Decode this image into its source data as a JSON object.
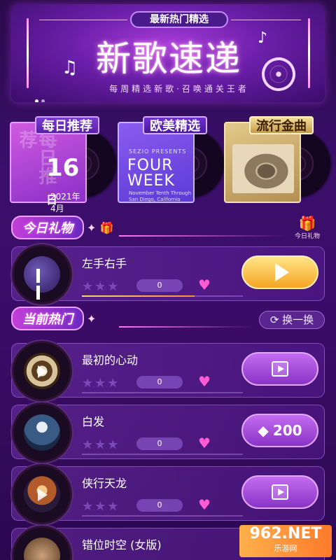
{
  "banner": {
    "pill": "最新热门精选",
    "title": "新歌速递",
    "subtitle": "每周精选新歌·召唤通关王者"
  },
  "categories": [
    {
      "label": "每日推荐",
      "day": "16",
      "day_unit": "日",
      "month": "2021年4月",
      "vertical": "每日推荐"
    },
    {
      "label": "欧美精选",
      "presents": "SEZIO PRESENTS",
      "cover_title": "FOUR WEEK",
      "cover_small": "November Tenth Through San Diego, California"
    },
    {
      "label": "流行金曲"
    }
  ],
  "gift_section": {
    "title": "今日礼物",
    "gift_label": "今日礼物"
  },
  "hot_section": {
    "title": "当前热门",
    "swap_label": "换一换"
  },
  "rows": [
    {
      "title": "左手右手",
      "score": "0",
      "action": "play",
      "progress": 0.7
    },
    {
      "title": "最初的心动",
      "score": "0",
      "action": "video",
      "progress": 0.0
    },
    {
      "title": "白发",
      "score": "0",
      "action": "diamond",
      "count": "200",
      "progress": 0.0
    },
    {
      "title": "侠行天龙",
      "score": "0",
      "action": "video",
      "progress": 0.0
    },
    {
      "title": "错位时空 (女版)"
    }
  ],
  "watermark": {
    "line1": "962.NET",
    "line2": "乐游网"
  }
}
